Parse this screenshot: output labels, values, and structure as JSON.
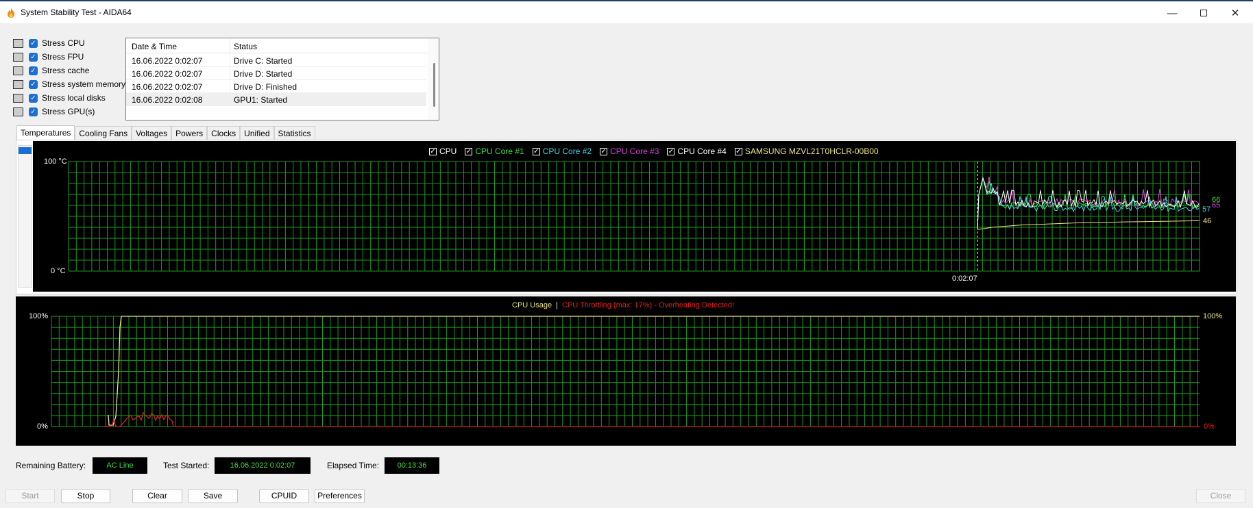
{
  "window": {
    "title": "System Stability Test - AIDA64"
  },
  "stress": [
    {
      "label": "Stress CPU",
      "checked": true,
      "icon": "cpu-chip-icon"
    },
    {
      "label": "Stress FPU",
      "checked": true,
      "icon": "fpu-icon"
    },
    {
      "label": "Stress cache",
      "checked": true,
      "icon": "cache-icon"
    },
    {
      "label": "Stress system memory",
      "checked": true,
      "icon": "memory-module-icon"
    },
    {
      "label": "Stress local disks",
      "checked": true,
      "icon": "disk-drive-icon"
    },
    {
      "label": "Stress GPU(s)",
      "checked": true,
      "icon": "monitor-icon"
    }
  ],
  "log": {
    "col_datetime": "Date & Time",
    "col_status": "Status",
    "rows": [
      {
        "datetime": "16.06.2022 0:02:07",
        "status": "Drive C: Started"
      },
      {
        "datetime": "16.06.2022 0:02:07",
        "status": "Drive D: Started"
      },
      {
        "datetime": "16.06.2022 0:02:07",
        "status": "Drive D: Finished"
      },
      {
        "datetime": "16.06.2022 0:02:08",
        "status": "GPU1: Started"
      }
    ]
  },
  "tabs": [
    "Temperatures",
    "Cooling Fans",
    "Voltages",
    "Powers",
    "Clocks",
    "Unified",
    "Statistics"
  ],
  "temperature_graph": {
    "legend": [
      {
        "name": "CPU",
        "color": "#ffffff"
      },
      {
        "name": "CPU Core #1",
        "color": "#3fe03f"
      },
      {
        "name": "CPU Core #2",
        "color": "#3fd8e8"
      },
      {
        "name": "CPU Core #3",
        "color": "#e040e0"
      },
      {
        "name": "CPU Core #4",
        "color": "#ffffff"
      },
      {
        "name": "SAMSUNG MZVL21T0HCLR-00B00",
        "color": "#f0e68c"
      }
    ],
    "y_max_label": "100 °C",
    "y_min_label": "0 °C",
    "time_label": "0:02:07",
    "end_values": {
      "top": "66",
      "mid": "65",
      "low": "57",
      "disk": "46"
    },
    "grid_color": "#1c9a1c"
  },
  "usage_graph": {
    "title_usage": "CPU Usage",
    "separator": "|",
    "title_throttle": "CPU Throttling (max: 17%) - Overheating Detected!",
    "left_top": "100%",
    "left_bottom": "0%",
    "right_top": "100%",
    "right_bottom": "0%",
    "usage_color": "#f0e68c",
    "throttle_color": "#e02020"
  },
  "info": {
    "battery_label": "Remaining Battery:",
    "battery_value": "AC Line",
    "started_label": "Test Started:",
    "started_value": "16.06.2022 0:02:07",
    "elapsed_label": "Elapsed Time:",
    "elapsed_value": "00:13:36"
  },
  "buttons": {
    "start": "Start",
    "stop": "Stop",
    "clear": "Clear",
    "save": "Save",
    "cpuid": "CPUID",
    "preferences": "Preferences",
    "close": "Close"
  }
}
